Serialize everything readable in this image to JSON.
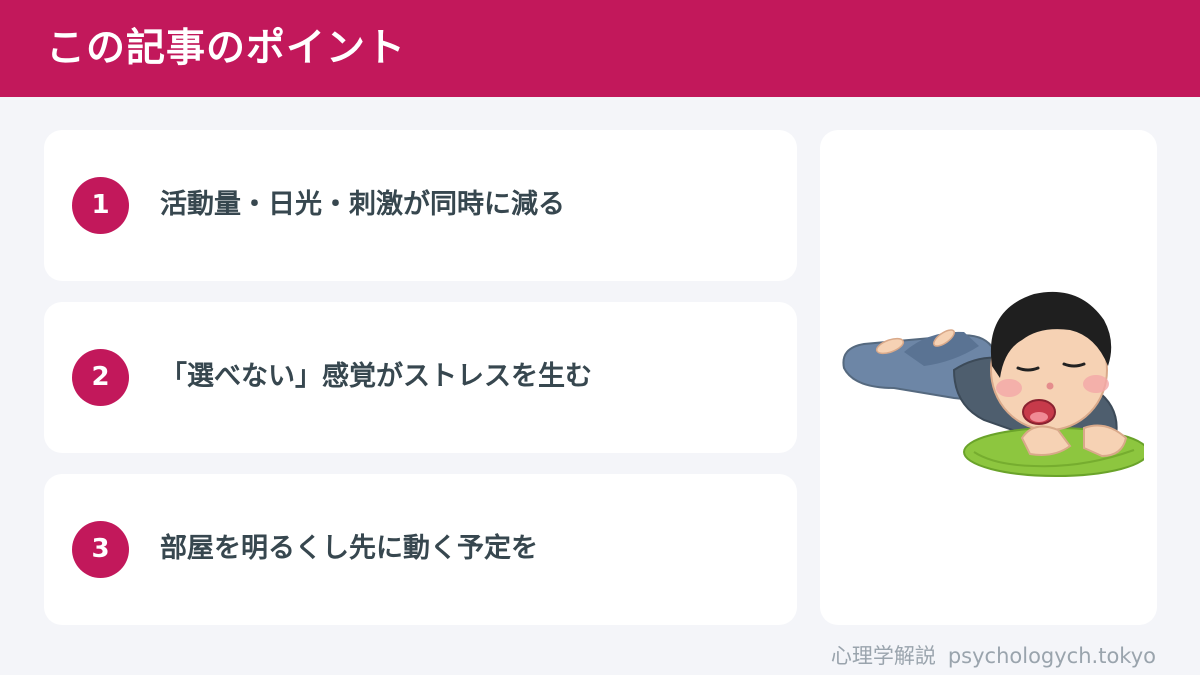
{
  "header": {
    "title": "この記事のポイント",
    "background_color": "#c2185b"
  },
  "points": [
    {
      "number": "1",
      "text": "活動量・日光・刺激が同時に減る"
    },
    {
      "number": "2",
      "text": "「選べない」感覚がストレスを生む"
    },
    {
      "number": "3",
      "text": "部屋を明るくし先に動く予定を"
    }
  ],
  "accent_color": "#c2185b",
  "illustration": {
    "icon": "lying-down-person-illustration"
  },
  "footer": {
    "label": "心理学解説",
    "site": "psychologych.tokyo"
  }
}
